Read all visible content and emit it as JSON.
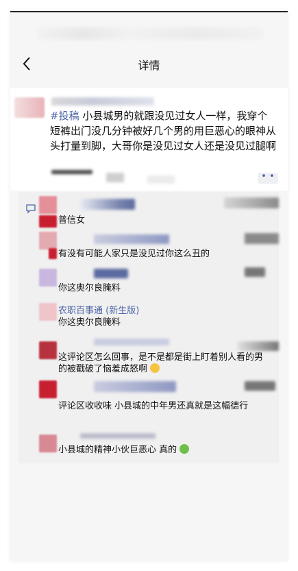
{
  "navbar": {
    "title": "详情"
  },
  "post": {
    "hashtag": "#投稿",
    "text": " 小县城男的就跟没见过女人一样，我穿个短裤出门没几分钟被好几个男的用巨恶心的眼神从头打量到脚，大哥你是没见过女人还是没见过腿啊"
  },
  "comments": [
    {
      "text": "普信女"
    },
    {
      "text": "有没有可能人家只是没见过你这么丑的"
    },
    {
      "text": "你这奥尔良腌料"
    },
    {
      "name": "农职百事通 (新生版)",
      "text": "你这奥尔良腌料"
    },
    {
      "text": "这评论区怎么回事，是不是都是街上盯着别人看的男的被戳破了恼羞成怒啊",
      "emoji": "flushed-face-icon"
    },
    {
      "text": "评论区收收味 小县城的中年男还真就是这幅德行"
    },
    {
      "text": "小县城的精神小伙巨恶心 真的",
      "emoji": "nauseated-face-icon"
    }
  ]
}
